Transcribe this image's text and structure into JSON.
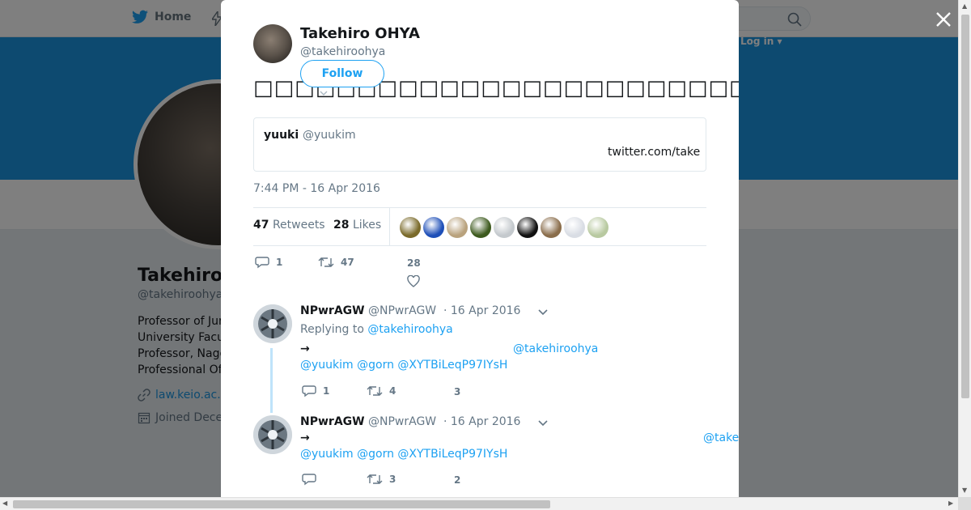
{
  "nav": {
    "home_label": "Home",
    "login_label": "Log in ▾"
  },
  "profile": {
    "name": "Takehiro",
    "handle": "@takehiroohya",
    "bio_lines": [
      "Professor of Jur",
      "University Facu",
      "Professor, Nago",
      "Professional Of"
    ],
    "link": "law.keio.ac.",
    "joined": "Joined Dece"
  },
  "tweet": {
    "author_name": "Takehiro OHYA",
    "author_handle": "@takehiroohya",
    "follow_label": "Follow",
    "text": "□□□□□□□□□□□□□□□□□□□□□□□□□□□□□□□□□□□□□□□□□□□□□□□□□",
    "quote": {
      "name": "yuuki",
      "handle": "@yuukim",
      "link": "twitter.com/take"
    },
    "timestamp": "7:44 PM - 16 Apr 2016",
    "retweets_count": "47",
    "retweets_label": "Retweets",
    "likes_count": "28",
    "likes_label": "Likes",
    "liker_colors": [
      "#7a6a2a",
      "#1e4fb8",
      "#b9a27d",
      "#3d5a1e",
      "#c4c9cd",
      "#111111",
      "#8a6d4b",
      "#d9dde4",
      "#b8c9a0"
    ],
    "action_counts": {
      "replies": "1",
      "retweets": "47",
      "likes": "28"
    }
  },
  "replies": [
    {
      "name": "NPwrAGW",
      "handle": "@NPwrAGW",
      "date": "· 16 Apr 2016",
      "replying_prefix": "Replying to",
      "replying_to": "@takehiroohya",
      "text": "→",
      "mention": "@takehiroohya",
      "links": "@yuukim @gorn @XYTBiLeqP97IYsH",
      "counts": {
        "replies": "1",
        "retweets": "4",
        "likes": "3"
      }
    },
    {
      "name": "NPwrAGW",
      "handle": "@NPwrAGW",
      "date": "· 16 Apr 2016",
      "text": "→",
      "mention": "@takehiroohya",
      "links": "@yuukim @gorn @XYTBiLeqP97IYsH",
      "counts": {
        "replies": "",
        "retweets": "3",
        "likes": "2"
      }
    }
  ],
  "colors": {
    "accent": "#1da1f2",
    "banner": "#1b95e0",
    "muted": "#657786"
  }
}
